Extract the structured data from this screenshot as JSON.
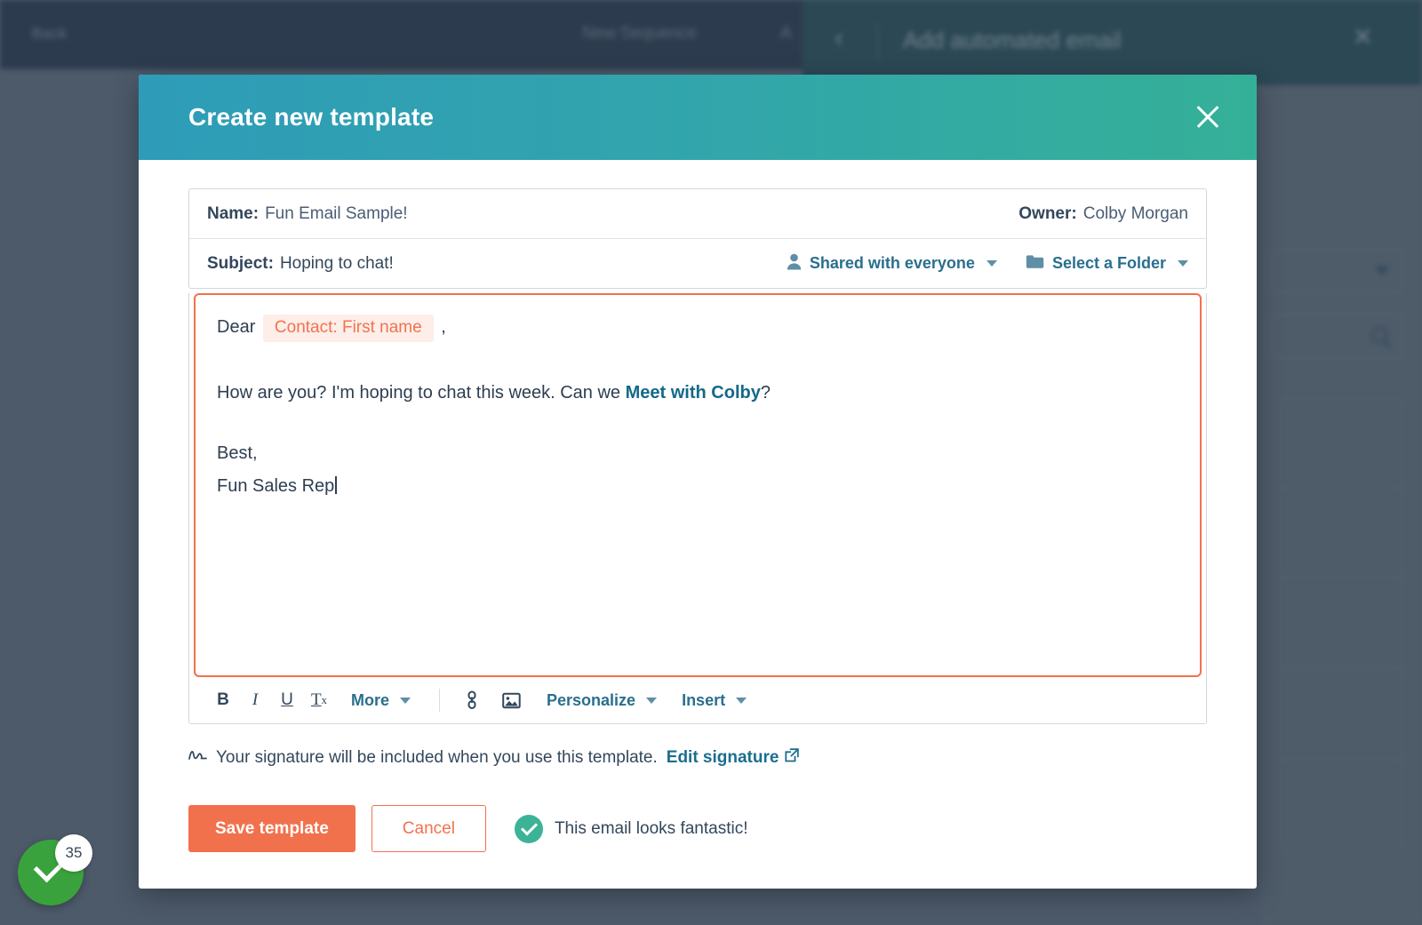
{
  "background": {
    "topbar": {
      "back_label": "Back",
      "center_title": "New Sequence",
      "right_label": "A"
    },
    "panel": {
      "back_icon": "chevron-left-icon",
      "title": "Add automated email",
      "close_icon": "close-icon"
    },
    "right_column": {
      "dropdown_icon": "chevron-down-icon",
      "search_icon": "search-icon"
    },
    "check_badge": {
      "icon": "check-icon",
      "count": "35"
    }
  },
  "modal": {
    "title": "Create new template",
    "close_icon": "close-icon",
    "fields": {
      "name_label": "Name:",
      "name_value": "Fun Email Sample!",
      "owner_label": "Owner:",
      "owner_value": "Colby Morgan",
      "subject_label": "Subject:",
      "subject_value": "Hoping to chat!",
      "share_icon": "person-icon",
      "share_label": "Shared with everyone",
      "folder_icon": "folder-icon",
      "folder_label": "Select a Folder"
    },
    "editor": {
      "greeting_prefix": "Dear",
      "token": "Contact: First name",
      "greeting_suffix": ",",
      "body_before_link": "How are you? I'm hoping to chat this week. Can we ",
      "body_link": "Meet with Colby",
      "body_after_link": "?",
      "closing": "Best,",
      "signature_name": "Fun Sales Rep"
    },
    "toolbar": {
      "bold": "B",
      "italic": "I",
      "underline": "U",
      "clear_format": "T",
      "clear_format_sub": "x",
      "more_label": "More",
      "link_icon": "link-icon",
      "image_icon": "image-icon",
      "personalize_label": "Personalize",
      "insert_label": "Insert"
    },
    "signature_note": {
      "icon": "signature-icon",
      "text": "Your signature will be included when you use this template.",
      "link_label": "Edit signature",
      "link_icon": "external-link-icon"
    },
    "footer": {
      "save_label": "Save template",
      "cancel_label": "Cancel",
      "status_icon": "check-circle-icon",
      "status_text": "This email looks fantastic!"
    }
  },
  "colors": {
    "header_gradient_start": "#2e9cb8",
    "header_gradient_end": "#35b098",
    "accent_orange": "#f2714d",
    "link_teal": "#2a6f8e",
    "token_bg": "#fdeee9",
    "status_green": "#3cb397",
    "badge_green": "#3aa23c",
    "page_backdrop": "#596776"
  }
}
